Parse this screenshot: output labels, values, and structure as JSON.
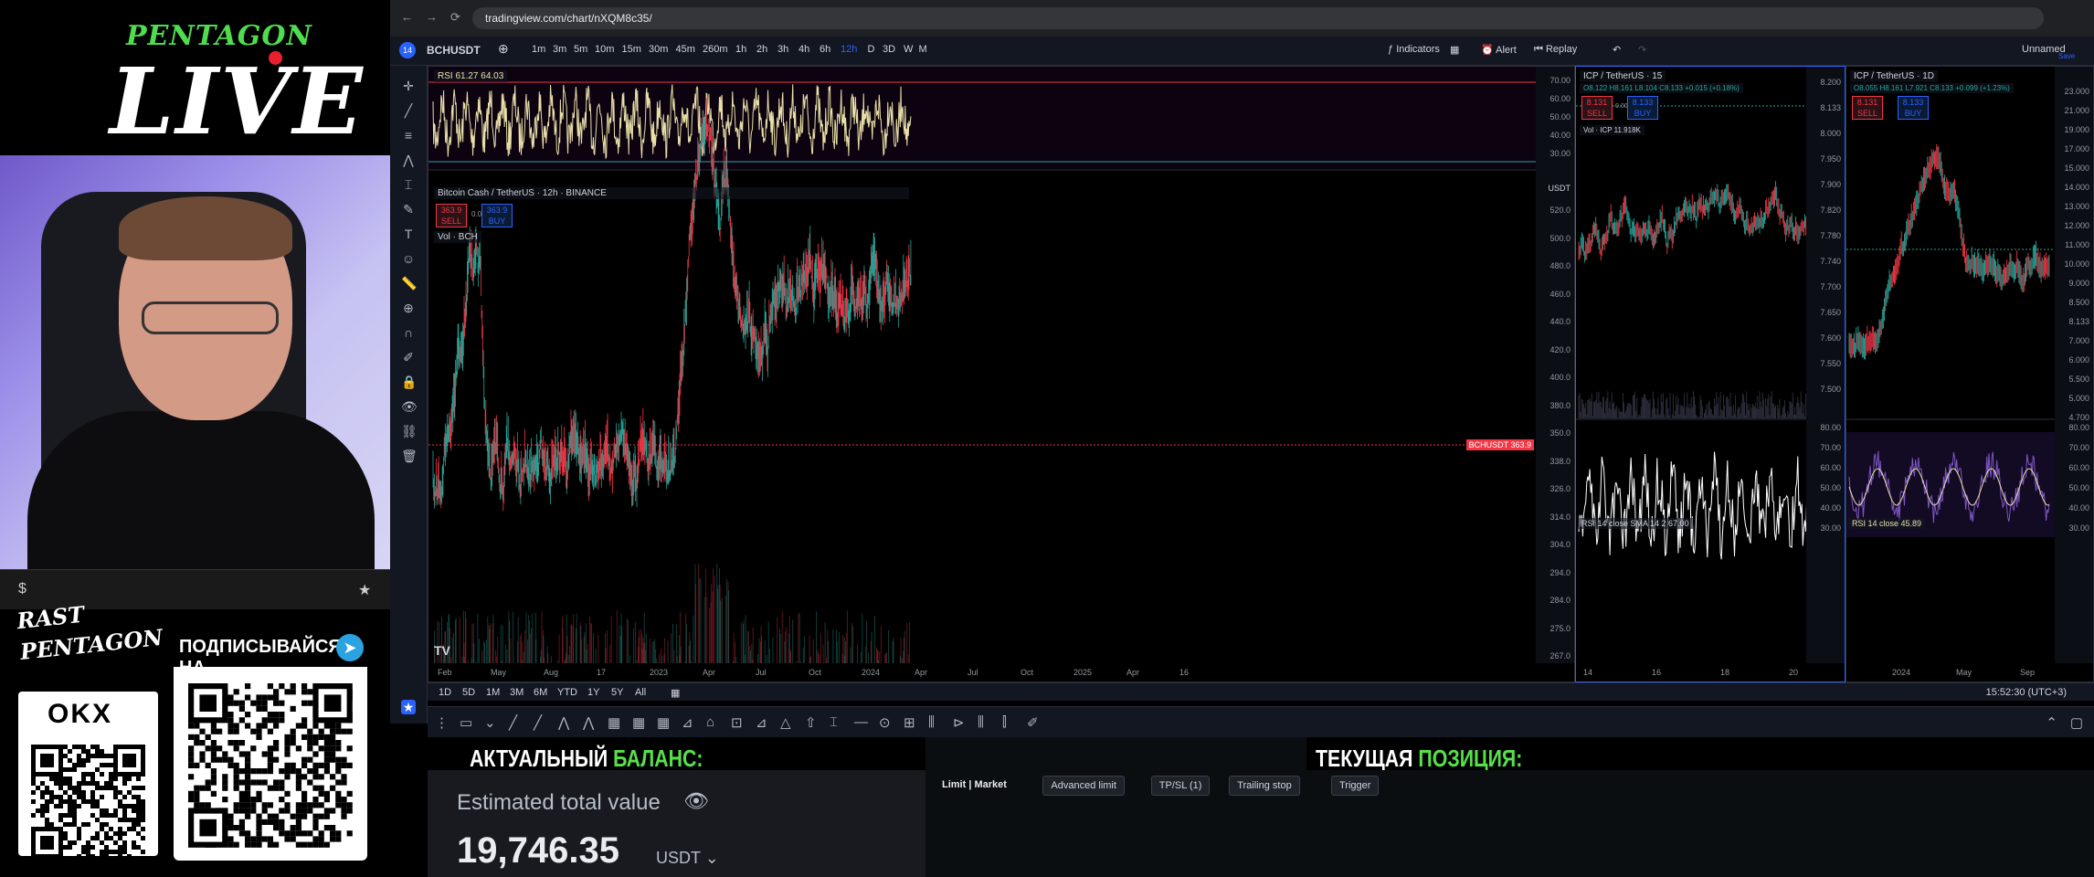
{
  "stream": {
    "brand_top": "PENTAGON",
    "brand_main": "LIVE",
    "ticker_symbol": "$",
    "ticker_star": "★",
    "rast_line1": "RAST",
    "rast_line2": "PENTAGON",
    "okx_logo": "OKX",
    "subscribe": "ПОДПИСЫВАЙСЯ НА",
    "telegram_glyph": "➤"
  },
  "browser": {
    "url": "tradingview.com/chart/nXQM8c35/",
    "tab_badge": "14"
  },
  "toolbar": {
    "symbol": "BCHUSDT",
    "intervals": [
      "1m",
      "3m",
      "5m",
      "10m",
      "15m",
      "30m",
      "45m",
      "260m",
      "1h",
      "2h",
      "3h",
      "4h",
      "6h",
      "12h",
      "D",
      "3D",
      "W",
      "M"
    ],
    "active_interval": "12h",
    "indicators": "Indicators",
    "alert": "Alert",
    "replay": "Replay",
    "layout_name": "Unnamed",
    "save": "Save"
  },
  "main_chart": {
    "title": "Bitcoin Cash / TetherUS · 12h · BINANCE",
    "rsi_label": "RSI 61.27 64.03",
    "sell_price": "363.9",
    "sell_label": "SELL",
    "spread": "0.0",
    "buy_price": "363.9",
    "buy_label": "BUY",
    "volume_label": "Vol · BCH",
    "price_tag": "BCHUSDT 363.9",
    "currency": "USDT",
    "rsi_axis": [
      "70.00",
      "60.00",
      "50.00",
      "40.00",
      "30.00"
    ],
    "price_axis": [
      "520.0",
      "500.0",
      "480.0",
      "460.0",
      "440.0",
      "420.0",
      "400.0",
      "380.0",
      "350.0",
      "338.0",
      "326.0",
      "314.0",
      "304.0",
      "294.0",
      "284.0",
      "275.0",
      "267.0"
    ],
    "x_axis": [
      "Feb",
      "May",
      "Aug",
      "17",
      "2023",
      "Apr",
      "Jul",
      "Oct",
      "2024",
      "Apr",
      "Jul",
      "Oct",
      "2025",
      "Apr",
      "16"
    ]
  },
  "icp15": {
    "title": "ICP / TetherUS · 15",
    "ohlc": "O8.122 H8.161 L8.104 C8.133 +0.015 (+0.18%)",
    "sell_price": "8.131",
    "buy_price": "8.133",
    "spread": "0.002",
    "volume": "Vol · ICP 11.918K",
    "rsi_label": "RSI 14 close SMA 14 2  67.00",
    "price_axis": [
      "8.200",
      "8.133",
      "8.000",
      "7.950",
      "7.900",
      "7.820",
      "7.780",
      "7.740",
      "7.700",
      "7.650",
      "7.600",
      "7.550",
      "7.500"
    ],
    "rsi_axis": [
      "80.00",
      "70.00",
      "60.00",
      "50.00",
      "40.00",
      "30.00"
    ],
    "x_axis": [
      "14",
      "16",
      "18",
      "20"
    ]
  },
  "icp1d": {
    "title": "ICP / TetherUS · 1D",
    "ohlc": "O8.055 H8.161 L7.921 C8.133 +0.099 (+1.23%)",
    "sell_price": "8.131",
    "buy_price": "8.133",
    "rsi_label": "RSI 14 close  45.89",
    "price_axis": [
      "23.000",
      "21.000",
      "19.000",
      "17.000",
      "15.000",
      "14.000",
      "13.000",
      "12.000",
      "11.000",
      "10.000",
      "9.000",
      "8.500",
      "8.133",
      "7.000",
      "6.000",
      "5.500",
      "5.000",
      "4.700"
    ],
    "rsi_axis": [
      "80.00",
      "70.00",
      "60.00",
      "50.00",
      "40.00",
      "30.00"
    ],
    "x_axis": [
      "2024",
      "May",
      "Sep"
    ]
  },
  "timebar": {
    "ranges": [
      "1D",
      "5D",
      "1M",
      "3M",
      "6M",
      "YTD",
      "1Y",
      "5Y",
      "All"
    ],
    "clock": "15:52:30 (UTC+3)"
  },
  "exchange": {
    "balance_title_1": "АКТУАЛЬНЫЙ",
    "balance_title_2": "БАЛАНС:",
    "position_title_1": "ТЕКУЩАЯ",
    "position_title_2": "ПОЗИЦИЯ:",
    "estimated_label": "Estimated total value",
    "estimated_value": "19,746.35",
    "estimated_unit": "USDT",
    "order_tabs": [
      "Limit | Market",
      "Advanced limit",
      "TP/SL (1)",
      "Trailing stop",
      "Trigger"
    ]
  },
  "colors": {
    "bull": "#26a69a",
    "bear": "#f23645",
    "rsi_line": "#e8e0a8",
    "accent": "#2962ff",
    "green_brand": "#58e04a"
  }
}
